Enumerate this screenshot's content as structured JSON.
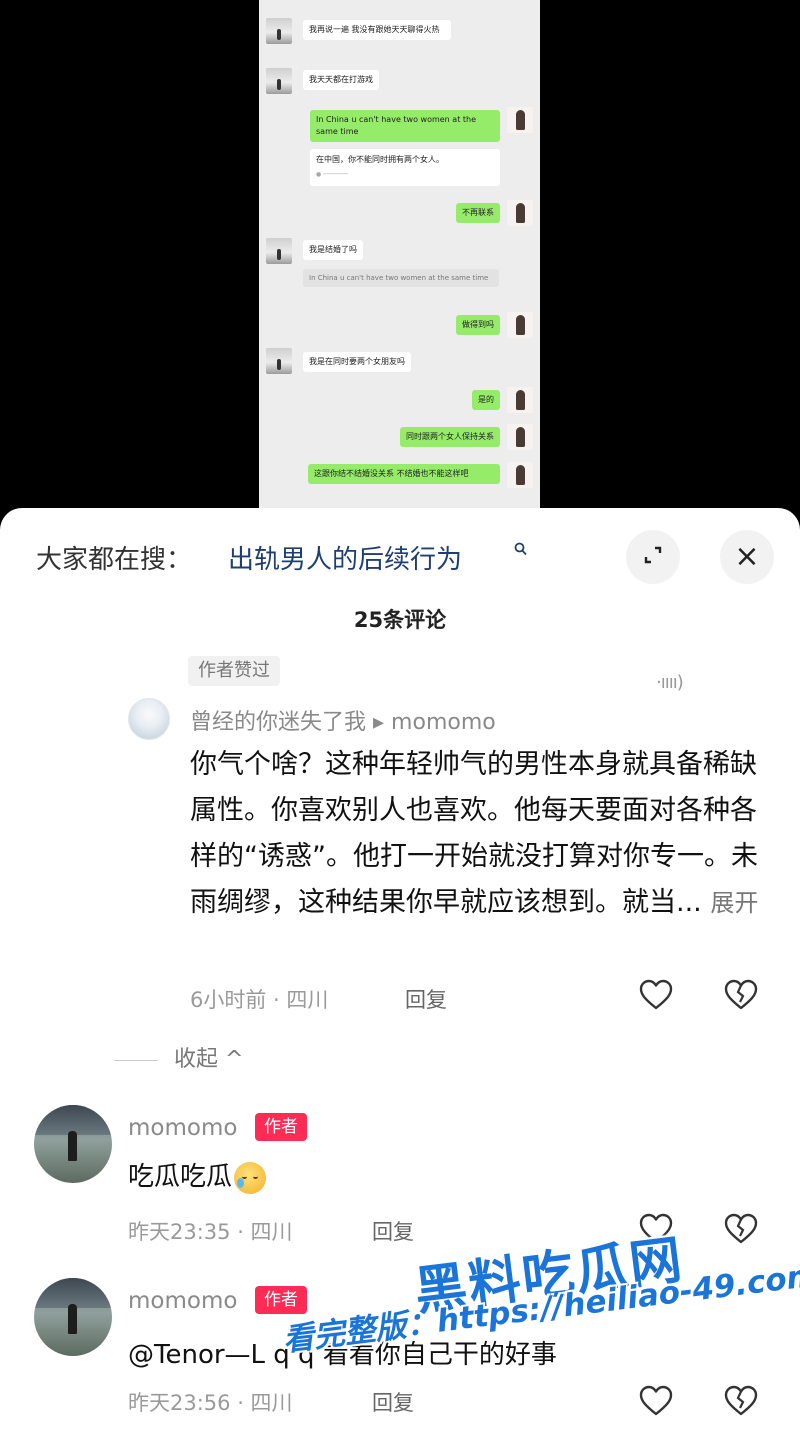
{
  "chat": {
    "msg1": "我再说一遍 我没有跟她天天聊得火热",
    "msg2": "我天天都在打游戏",
    "msg3": "In China u can't have two women at the same time",
    "msg3_translation": "在中国，你不能同时拥有两个女人。",
    "msg4": "不再联系",
    "msg5": "我是结婚了吗",
    "msg5_quote": "In China u can't have two women at the same time",
    "msg6": "做得到吗",
    "msg7": "我是在同时要两个女朋友吗",
    "msg8": "是的",
    "msg9": "同时跟两个女人保持关系",
    "msg10": "这跟你结不结婚没关系 不结婚也不能这样吧"
  },
  "header": {
    "search_prefix": "大家都在搜：",
    "search_link": "出轨男人的后续行为",
    "search_icon": "magnifier-icon",
    "expand_icon": "expand-icon",
    "close_icon": "×"
  },
  "comments_count": "25条评论",
  "comment1": {
    "author_liked": "作者赞过",
    "squiggle": "·ıııı)",
    "username": "曾经的你迷失了我",
    "reply_to": "▸ momomo",
    "body": "你气个啥？这种年轻帅气的男性本身就具备稀缺属性。你喜欢别人也喜欢。他每天要面对各种各样的“诱惑”。他打一开始就没打算对你专一。未雨绸缪，这种结果你早就应该想到。就当...",
    "expand": "展开",
    "meta": "6小时前 · 四川",
    "reply": "回复"
  },
  "collapse_label": "收起 ^",
  "replies": [
    {
      "username": "momomo",
      "badge": "作者",
      "text": "吃瓜吃瓜",
      "meta": "昨天23:35 · 四川",
      "reply": "回复"
    },
    {
      "username": "momomo",
      "badge": "作者",
      "text": "@Tenor—L q q  看看你自己干的好事",
      "meta": "昨天23:56 · 四川",
      "reply": "回复"
    }
  ],
  "watermark": {
    "brand": "黑料吃瓜网",
    "url": "看完整版：https://heiliao-49.com"
  },
  "colors": {
    "link": "#1f3f73",
    "badge": "#fe2c55",
    "bubble_green": "#95ec69",
    "watermark": "#1b74d8"
  }
}
